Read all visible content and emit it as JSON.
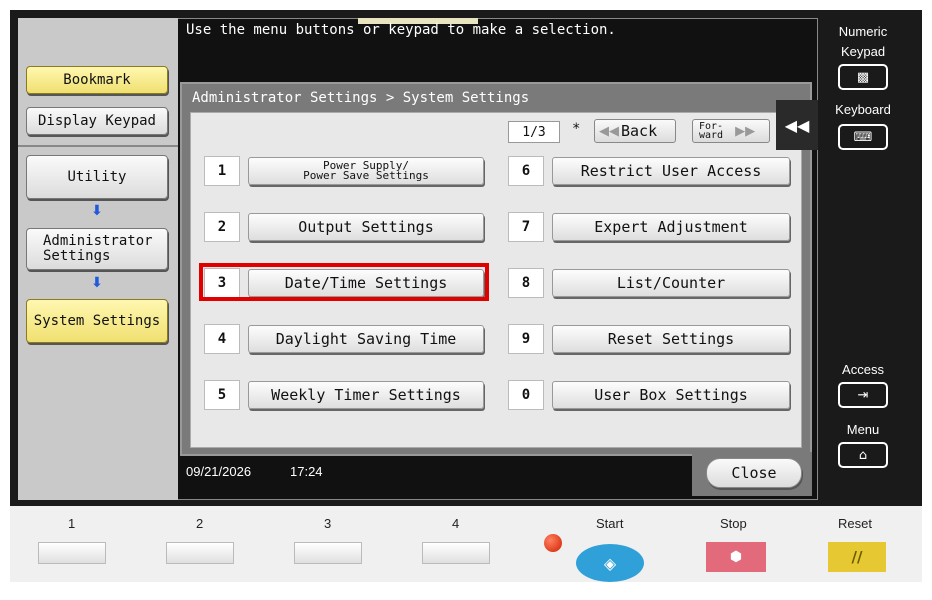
{
  "top_message": "Use the menu buttons or keypad to make a selection.",
  "left_panel": {
    "bookmark": "Bookmark",
    "display_keypad": "Display Keypad",
    "utility": "Utility",
    "administrator_settings_line1": "Administrator",
    "administrator_settings_line2": "Settings",
    "system_settings": "System Settings"
  },
  "dialog": {
    "breadcrumb": "Administrator Settings > System Settings",
    "page_indicator": "1/3",
    "star": "*",
    "back_label": "Back",
    "forward_line1": "For-",
    "forward_line2": "ward"
  },
  "menu_items": [
    {
      "number": "1",
      "line1": "Power Supply/",
      "line2": "Power Save Settings"
    },
    {
      "number": "2",
      "label": "Output Settings"
    },
    {
      "number": "3",
      "label": "Date/Time Settings"
    },
    {
      "number": "4",
      "label": "Daylight Saving Time"
    },
    {
      "number": "5",
      "label": "Weekly Timer Settings"
    },
    {
      "number": "6",
      "label": "Restrict User Access"
    },
    {
      "number": "7",
      "label": "Expert Adjustment"
    },
    {
      "number": "8",
      "label": "List/Counter"
    },
    {
      "number": "9",
      "label": "Reset Settings"
    },
    {
      "number": "0",
      "label": "User Box Settings"
    }
  ],
  "status": {
    "date": "09/21/2026",
    "time": "17:24",
    "close": "Close"
  },
  "right_panel": {
    "numeric_keypad_line1": "Numeric",
    "numeric_keypad_line2": "Keypad",
    "keyboard": "Keyboard",
    "access": "Access",
    "menu": "Menu"
  },
  "hardware": {
    "keys": [
      "1",
      "2",
      "3",
      "4"
    ],
    "start": "Start",
    "stop": "Stop",
    "reset": "Reset"
  },
  "colors": {
    "highlight": "#e00000",
    "start_button": "#2fa0d8",
    "stop_button": "#e36a7a",
    "reset_button": "#e6c832",
    "selected_yellow": "#f0e070"
  }
}
